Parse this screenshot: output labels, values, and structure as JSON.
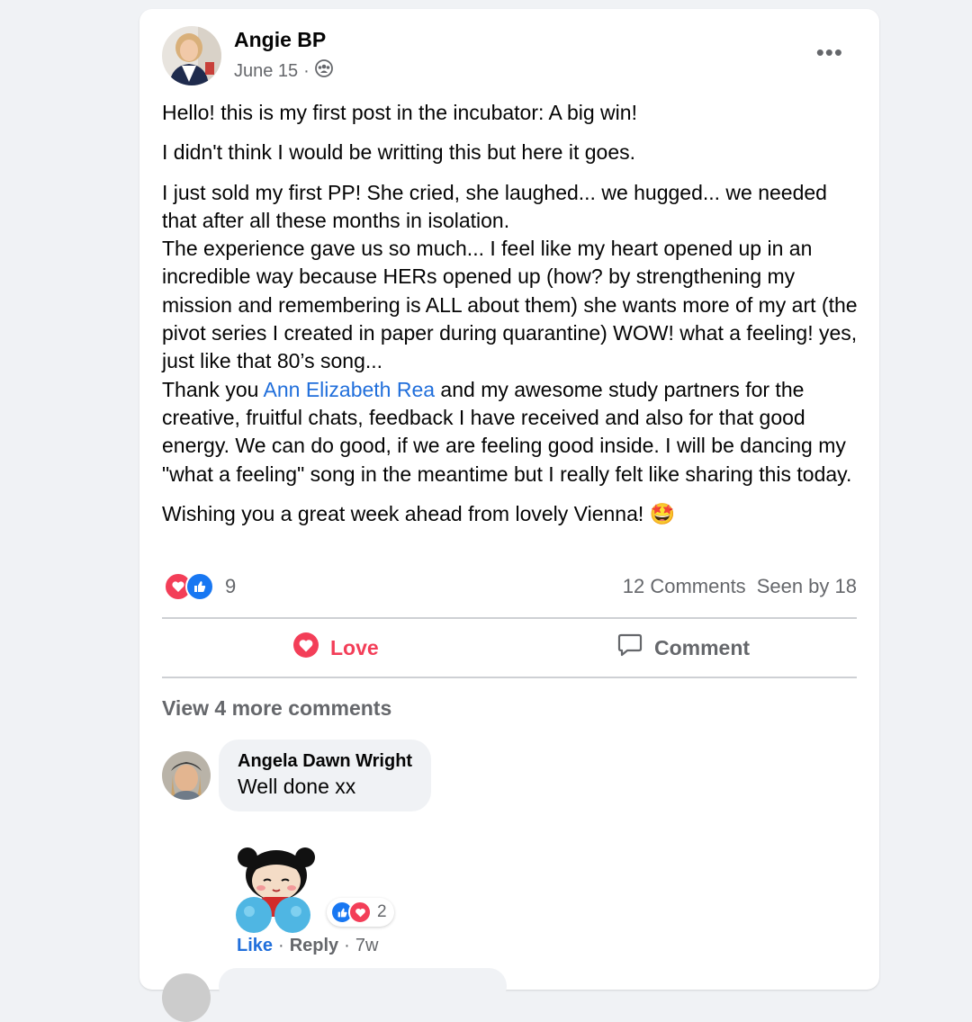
{
  "post": {
    "author": "Angie BP",
    "date": "June 15",
    "dot": "·",
    "privacy_icon": "group-icon",
    "paragraphs": [
      "Hello! this is my first post in the incubator: A big win!",
      "I didn't think I would be writting this but here it goes."
    ],
    "para3_line1": "I just sold my first PP! She cried, she laughed... we hugged... we needed that after all these months in isolation.",
    "para3_line2": "The experience gave us so much... I feel like my heart opened up in an incredible way because HERs opened up (how? by strengthening my mission and remembering is ALL about them) she wants more of my art (the pivot series I created in paper during quarantine) WOW! what a feeling! yes, just like that 80’s song...",
    "para3_thanks_prefix": "Thank you ",
    "mention": "Ann Elizabeth Rea",
    "para3_thanks_suffix": " and my awesome study partners for the creative, fruitful chats, feedback I have received and also for that good energy. We can do good, if we are feeling good inside. I will be dancing my \"what a feeling\" song in the meantime but I really felt like sharing this today.",
    "closing": "Wishing you a great week ahead from lovely Vienna!",
    "closing_emoji": "🤩"
  },
  "stats": {
    "reaction_count": "9",
    "comments": "12 Comments",
    "seen_by": "Seen by 18"
  },
  "actions": {
    "love_label": "Love",
    "comment_label": "Comment"
  },
  "comments": {
    "view_more": "View 4 more comments",
    "items": [
      {
        "name": "Angela Dawn Wright",
        "text": "Well done xx",
        "reaction_count": "2",
        "like_label": "Like",
        "reply_label": "Reply",
        "dot": "·",
        "time": "7w"
      }
    ]
  },
  "colors": {
    "love": "#f33e58",
    "like": "#1877f2",
    "link": "#216fdb",
    "muted": "#65676b"
  }
}
